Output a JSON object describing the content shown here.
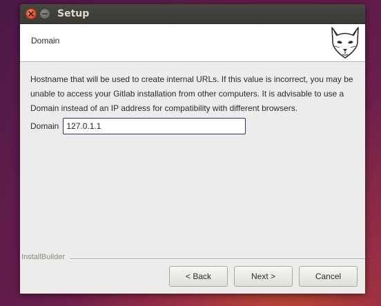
{
  "window": {
    "title": "Setup"
  },
  "header": {
    "title": "Domain",
    "logo_icon": "gitlab-fox-logo-icon"
  },
  "content": {
    "description": "Hostname that will be used to create internal URLs. If this value is incorrect, you may be unable to access your Gitlab installation from other computers. It is advisable to use a Domain instead of an IP address for compatibility with different browsers.",
    "domain_field": {
      "label": "Domain",
      "value": "127.0.1.1"
    }
  },
  "footer": {
    "caption": "InstallBuilder",
    "back_label": "< Back",
    "next_label": "Next >",
    "cancel_label": "Cancel"
  },
  "colors": {
    "close_button": "#e4532a",
    "titlebar": "#3f3e39",
    "input_border": "#2c2f6e",
    "window_bg": "#edecea"
  }
}
